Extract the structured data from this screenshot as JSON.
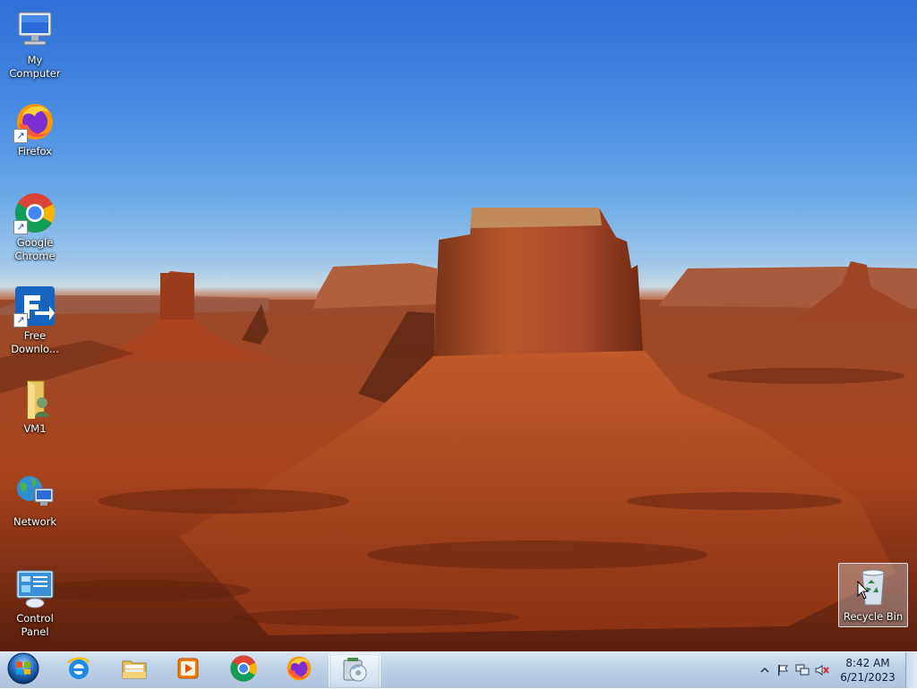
{
  "desktop": {
    "icons": [
      {
        "label": "My Computer",
        "icon": "computer-icon"
      },
      {
        "label": "Firefox",
        "icon": "firefox-icon",
        "shortcut": true
      },
      {
        "label": "Google Chrome",
        "icon": "chrome-icon",
        "shortcut": true
      },
      {
        "label": "Free Downlo...",
        "icon": "free-download-manager-icon",
        "shortcut": true
      },
      {
        "label": "VM1",
        "icon": "user-folder-icon"
      },
      {
        "label": "Network",
        "icon": "network-icon"
      },
      {
        "label": "Control Panel",
        "icon": "control-panel-icon"
      },
      {
        "label": "Recycle Bin",
        "icon": "recycle-bin-icon",
        "selected": true
      }
    ]
  },
  "taskbar": {
    "start": {
      "icon": "windows-start-orb-icon"
    },
    "pinned": [
      {
        "name": "internet-explorer",
        "icon": "internet-explorer-icon"
      },
      {
        "name": "file-explorer",
        "icon": "file-explorer-icon"
      },
      {
        "name": "media-player",
        "icon": "media-player-icon"
      },
      {
        "name": "chrome",
        "icon": "chrome-icon"
      },
      {
        "name": "firefox",
        "icon": "firefox-icon"
      },
      {
        "name": "disc-app",
        "icon": "disc-app-icon",
        "active": true
      }
    ],
    "tray": {
      "icons": [
        "show-hidden-icons-chevron-icon",
        "action-center-flag-icon",
        "network-status-icon",
        "volume-muted-icon"
      ],
      "time": "8:42 AM",
      "date": "6/21/2023"
    }
  },
  "colors": {
    "sky_top": "#2f6fd6",
    "desert": "#b34a22",
    "taskbar": "#bcd0e6"
  }
}
